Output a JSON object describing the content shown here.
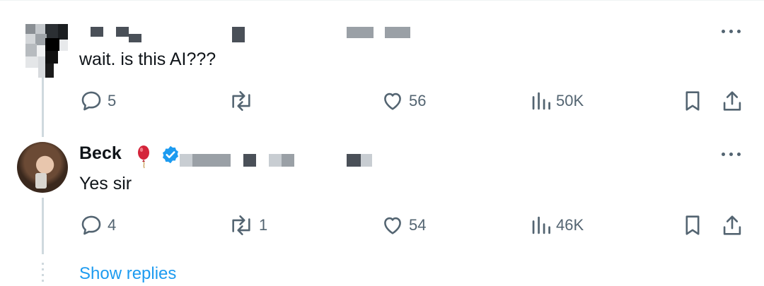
{
  "tweets": [
    {
      "text": "wait. is this AI???",
      "actions": {
        "replies": "5",
        "reposts": "",
        "likes": "56",
        "views": "50K"
      }
    },
    {
      "author_name": "Beck",
      "text": "Yes sir",
      "actions": {
        "replies": "4",
        "reposts": "1",
        "likes": "54",
        "views": "46K"
      }
    }
  ],
  "show_replies_label": "Show replies",
  "icons": {
    "reply": "speech-bubble-icon",
    "repost": "repost-arrows-icon",
    "like": "heart-icon",
    "views": "bar-chart-icon",
    "bookmark": "bookmark-icon",
    "share": "share-upload-icon",
    "more": "more-dots-icon",
    "verified": "verified-badge-icon",
    "emoji": "balloon-emoji-icon"
  },
  "colors": {
    "accent": "#1d9bf0",
    "muted": "#536471",
    "text": "#0f1419",
    "verified": "#1d9bf0"
  }
}
